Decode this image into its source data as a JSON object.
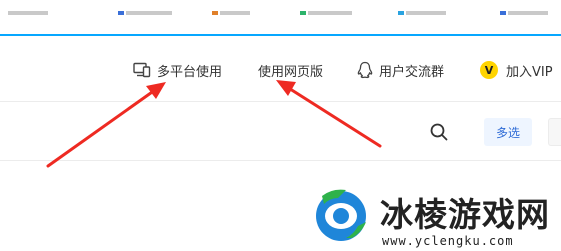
{
  "header": {
    "items": [
      {
        "label": "多平台使用",
        "icon": "devices-icon"
      },
      {
        "label": "使用网页版"
      },
      {
        "label": "用户交流群",
        "icon": "qq-penguin-icon"
      },
      {
        "label": "加入VIP",
        "badge": "V",
        "icon": "vip-badge-icon"
      }
    ]
  },
  "search_row": {
    "multi_select_label": "多选"
  },
  "watermark": {
    "title": "冰棱游戏网",
    "url": "www.yclengku.com"
  },
  "colors": {
    "accent_line": "#06a7ff",
    "arrow": "#ee2a22",
    "vip_badge": "#ffd400",
    "multi_select_text": "#2e6bd6"
  }
}
